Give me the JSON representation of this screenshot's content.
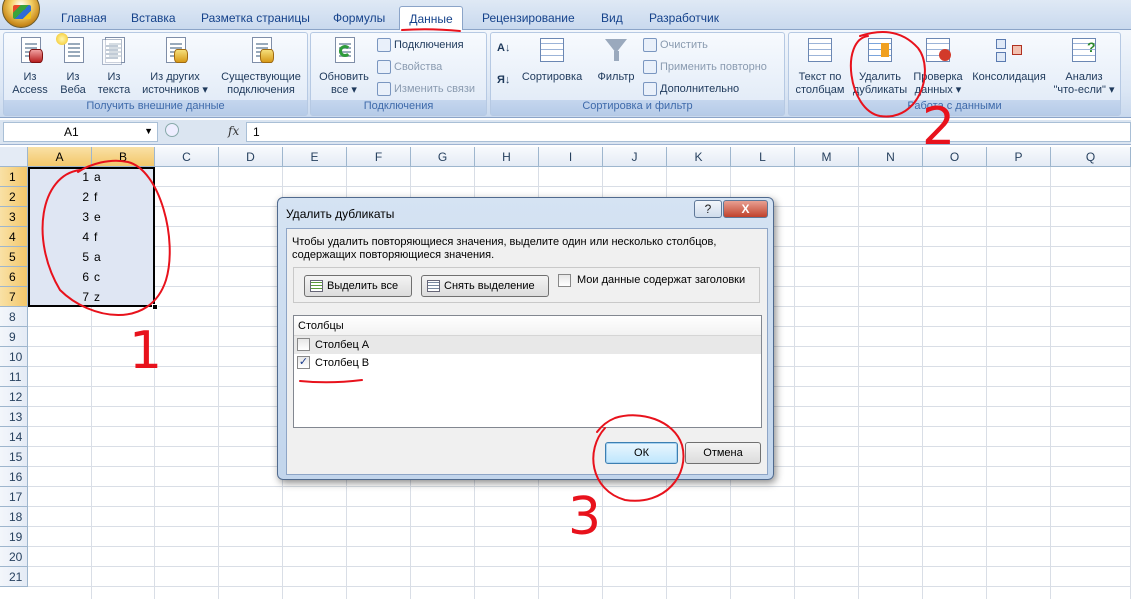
{
  "ribbon_tabs": [
    "Главная",
    "Вставка",
    "Разметка страницы",
    "Формулы",
    "Данные",
    "Рецензирование",
    "Вид",
    "Разработчик"
  ],
  "active_tab": "Данные",
  "groups": {
    "external": {
      "label": "Получить внешние данные",
      "from_access_1": "Из",
      "from_access_2": "Access",
      "from_web_1": "Из",
      "from_web_2": "Веба",
      "from_text_1": "Из",
      "from_text_2": "текста",
      "from_other_1": "Из других",
      "from_other_2": "источников",
      "existing_1": "Существующие",
      "existing_2": "подключения"
    },
    "connections": {
      "label": "Подключения",
      "refresh_1": "Обновить",
      "refresh_2": "все",
      "connections": "Подключения",
      "properties": "Свойства",
      "edit_links": "Изменить связи"
    },
    "sort_filter": {
      "label": "Сортировка и фильтр",
      "sort": "Сортировка",
      "filter": "Фильтр",
      "clear": "Очистить",
      "reapply": "Применить повторно",
      "advanced": "Дополнительно"
    },
    "data_tools": {
      "label": "Работа с данными",
      "text_to_cols_1": "Текст по",
      "text_to_cols_2": "столбцам",
      "remove_dups_1": "Удалить",
      "remove_dups_2": "дубликаты",
      "validation_1": "Проверка",
      "validation_2": "данных",
      "consolidate": "Консолидация",
      "whatif_1": "Анализ",
      "whatif_2": "\"что-если\""
    }
  },
  "formula_bar": {
    "name_box": "A1",
    "fx": "fx",
    "value": "1"
  },
  "columns": [
    "A",
    "B",
    "C",
    "D",
    "E",
    "F",
    "G",
    "H",
    "I",
    "J",
    "K",
    "L",
    "M",
    "N",
    "O",
    "P",
    "Q"
  ],
  "rows": [
    "1",
    "2",
    "3",
    "4",
    "5",
    "6",
    "7",
    "8",
    "9",
    "10",
    "11",
    "12",
    "13",
    "14",
    "15",
    "16",
    "17",
    "18",
    "19",
    "20",
    "21"
  ],
  "cells": [
    {
      "a": "1",
      "b": "a"
    },
    {
      "a": "2",
      "b": "f"
    },
    {
      "a": "3",
      "b": "e"
    },
    {
      "a": "4",
      "b": "f"
    },
    {
      "a": "5",
      "b": "a"
    },
    {
      "a": "6",
      "b": "c"
    },
    {
      "a": "7",
      "b": "z"
    }
  ],
  "dialog": {
    "title": "Удалить дубликаты",
    "help": "?",
    "close": "X",
    "description_1": "Чтобы удалить повторяющиеся значения, выделите один или несколько столбцов,",
    "description_2": "содержащих повторяющиеся значения.",
    "select_all": "Выделить все",
    "unselect_all": "Снять выделение",
    "headers_checkbox": "Мои данные содержат заголовки",
    "columns_header": "Столбцы",
    "column_a": "Столбец A",
    "column_b": "Столбец B",
    "ok": "ОК",
    "cancel": "Отмена"
  },
  "annotations": [
    "1",
    "2",
    "3"
  ],
  "colors": {
    "annotation_red": "#e8121c",
    "ribbon_blue": "#dbe6f4",
    "selection": "#dfe6f3"
  }
}
